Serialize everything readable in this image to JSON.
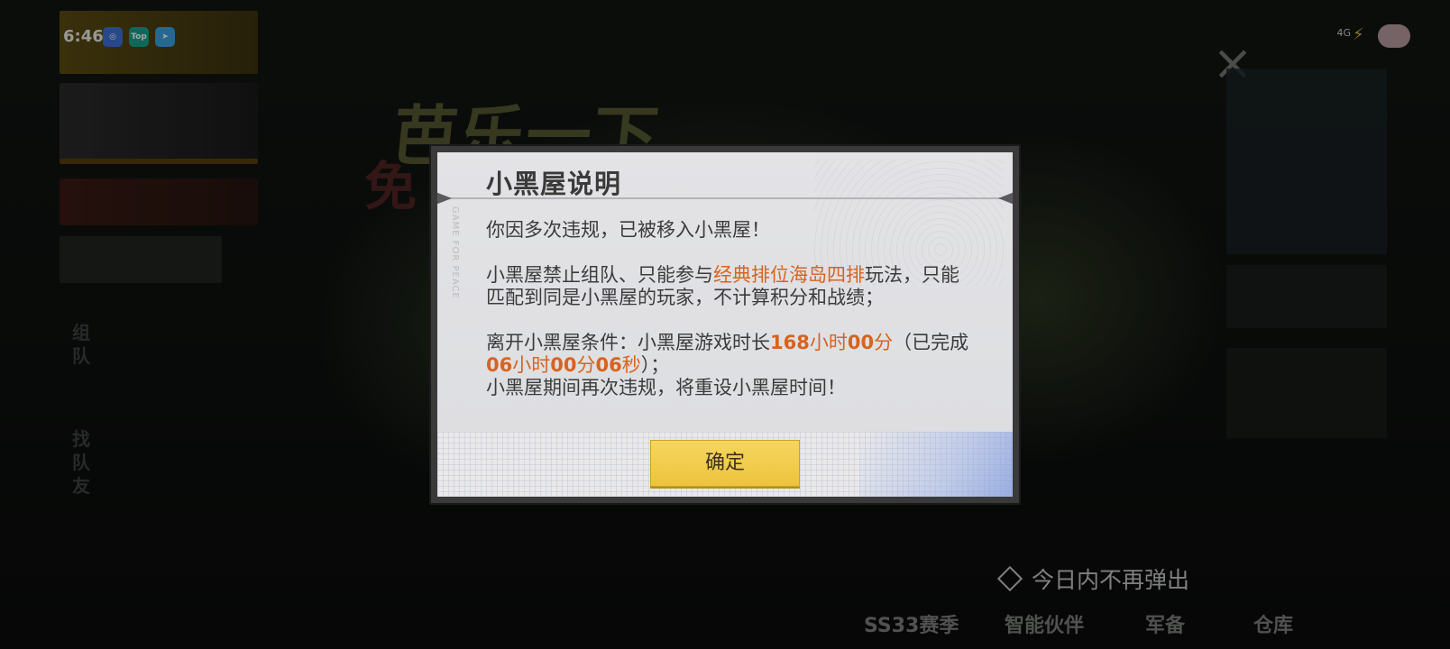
{
  "status_bar": {
    "time": "6:46",
    "apps": [
      "Top"
    ],
    "network": "4G"
  },
  "background": {
    "title_main": "芭乐一下",
    "title_sub": "免",
    "dont_show_again": "今日内不再弹出",
    "left_labels": [
      "组队",
      "找队友"
    ],
    "bottom_nav": [
      "SS33赛季",
      "智能伙伴",
      "军备",
      "仓库"
    ]
  },
  "dialog": {
    "title": "小黑屋说明",
    "line1": "你因多次违规，已被移入小黑屋！",
    "p2_a": "小黑屋禁止组队、只能参与",
    "p2_highlight": "经典排位海岛四排",
    "p2_b": "玩法，只能匹配到同是小黑屋的玩家，不计算积分和战绩；",
    "p3_a": "离开小黑屋条件：小黑屋游戏时长",
    "p3_n1": "168",
    "p3_u1": "小时",
    "p3_n2": "00",
    "p3_u2": "分",
    "p3_b": "（已完成",
    "p3_n3": "06",
    "p3_u3": "小时",
    "p3_n4": "00",
    "p3_u4": "分",
    "p3_n5": "06",
    "p3_u5": "秒",
    "p3_c": "）；",
    "p4": "小黑屋期间再次违规，将重设小黑屋时间！",
    "confirm_label": "确定",
    "watermark": "GAME FOR PEACE"
  },
  "colors": {
    "highlight": "#d8631e",
    "button": "#f0c845",
    "dialog_bg": "#e0e1e4"
  }
}
